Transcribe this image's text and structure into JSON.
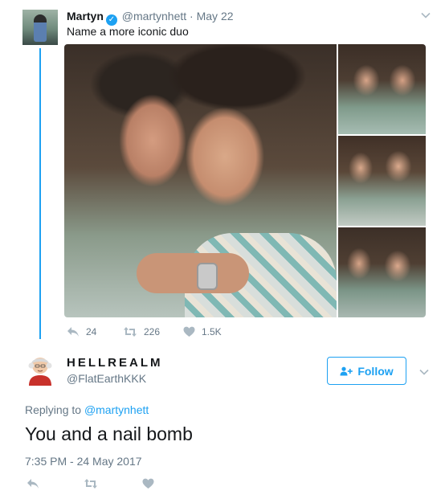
{
  "parent_tweet": {
    "author_name": "Martyn",
    "verified": true,
    "handle": "@martynhett",
    "separator": "·",
    "date": "May 22",
    "text": "Name a more iconic duo",
    "replies": "24",
    "retweets": "226",
    "likes": "1.5K"
  },
  "tweet": {
    "author_name": "HELLREALM",
    "handle": "@FlatEarthKKK",
    "follow_label": "Follow",
    "replying_prefix": "Replying to",
    "replying_to": "@martynhett",
    "text": "You and a nail bomb",
    "timestamp": "7:35 PM - 24 May 2017"
  },
  "colors": {
    "accent": "#1da1f2",
    "muted": "#657786",
    "text": "#14171a"
  },
  "icons": {
    "reply": "reply-icon",
    "retweet": "retweet-icon",
    "like": "heart-icon",
    "more": "chevron-down-icon",
    "follow": "add-user-icon",
    "verified": "verified-badge-icon"
  }
}
